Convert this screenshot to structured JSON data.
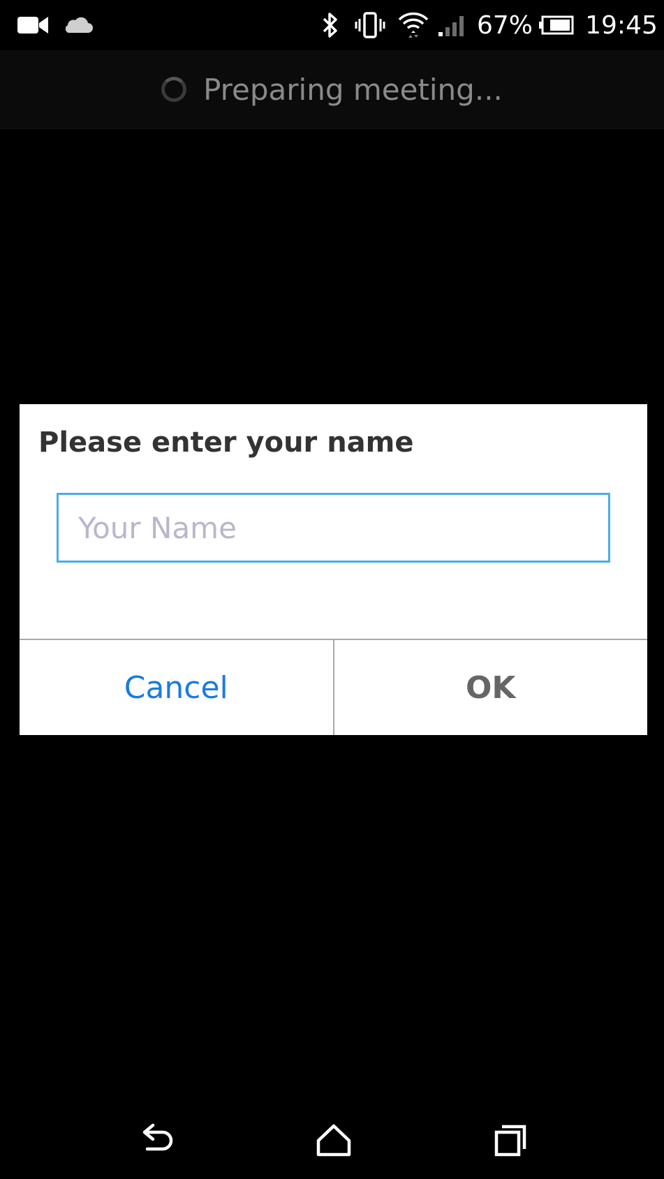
{
  "status_bar": {
    "left_icons": [
      "video-camera-icon",
      "cloud-icon"
    ],
    "right_icons": [
      "bluetooth-icon",
      "vibrate-icon",
      "wifi-icon",
      "cellular-signal-icon",
      "battery-icon"
    ],
    "battery_percent": "67%",
    "time": "19:45"
  },
  "header": {
    "status_text": "Preparing meeting..."
  },
  "dialog": {
    "title": "Please enter your name",
    "input_value": "",
    "input_placeholder": "Your Name",
    "cancel_label": "Cancel",
    "ok_label": "OK"
  },
  "nav_bar": {
    "icons": [
      "back-icon",
      "home-icon",
      "recents-icon"
    ]
  },
  "colors": {
    "background": "#000000",
    "dialog_background": "#ffffff",
    "accent_blue": "#1a7be0",
    "input_border": "#4aaee4",
    "placeholder": "#b9b6cc"
  }
}
